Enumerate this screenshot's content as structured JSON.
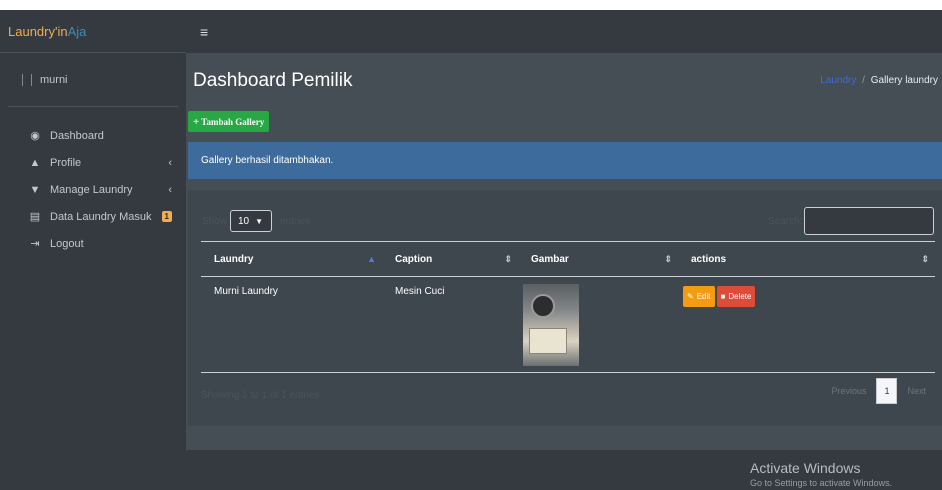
{
  "brand": {
    "part1": "Laundry'in",
    "part2": "Aja"
  },
  "user": {
    "name": "murni"
  },
  "sidebar": {
    "items": [
      {
        "label": "Dashboard",
        "icon": "dashboard-icon",
        "glyph": "◉",
        "chevron": ""
      },
      {
        "label": "Profile",
        "icon": "user-icon",
        "glyph": "▲",
        "chevron": "‹"
      },
      {
        "label": "Manage Laundry",
        "icon": "shirt-icon",
        "glyph": "▼",
        "chevron": "‹"
      },
      {
        "label": "Data Laundry Masuk",
        "icon": "document-icon",
        "glyph": "▤",
        "chevron": "",
        "badge": "1"
      },
      {
        "label": "Logout",
        "icon": "logout-icon",
        "glyph": "⇥",
        "chevron": ""
      }
    ]
  },
  "header": {
    "menu_glyph": "≡"
  },
  "page": {
    "title": "Dashboard Pemilik",
    "breadcrumb": {
      "link": "Laundry",
      "separator": "/",
      "current": "Gallery laundry"
    }
  },
  "add_button": {
    "label": "Tambah Gallery",
    "glyph": "+"
  },
  "alert": {
    "text": "Gallery berhasil ditambhakan."
  },
  "table_controls": {
    "show_label": "Show",
    "entries_value": "10",
    "entries_label": "entries",
    "search_label": "Search:"
  },
  "table": {
    "columns": [
      "Laundry",
      "Caption",
      "Gambar",
      "actions"
    ],
    "rows": [
      {
        "laundry": "Murni Laundry",
        "caption": "Mesin Cuci",
        "edit_label": "Edit",
        "delete_label": "Delete"
      }
    ]
  },
  "pagination": {
    "info": "Showing 1 to 1 of 1 entries",
    "previous": "Previous",
    "current_page": "1",
    "next": "Next"
  },
  "watermark": {
    "line1": "Activate Windows",
    "line2": "Go to Settings to activate Windows."
  },
  "colors": {
    "sidebar_bg": "#343a40",
    "content_bg": "#454d55",
    "success": "#28a745",
    "alert_bg": "#3d6b9c",
    "warning": "#f39c12",
    "danger": "#dd4b39",
    "brand_accent": "#f0ad4e"
  }
}
